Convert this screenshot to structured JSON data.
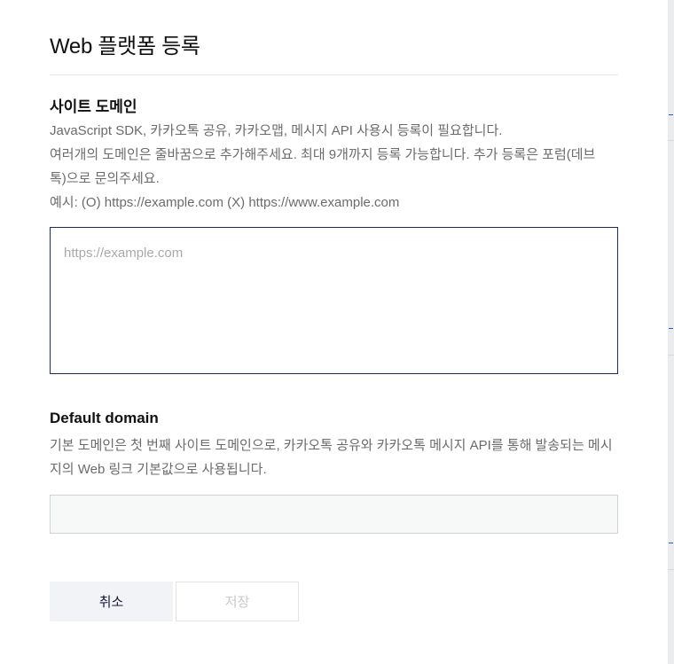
{
  "modal": {
    "title": "Web 플랫폼 등록"
  },
  "site_domain": {
    "heading": "사이트 도메인",
    "lines": [
      "JavaScript SDK, 카카오톡 공유, 카카오맵, 메시지 API 사용시 등록이 필요합니다.",
      "여러개의 도메인은 줄바꿈으로 추가해주세요. 최대 9개까지 등록 가능합니다. 추가 등록은 포럼(데브",
      "톡)으로 문의주세요.",
      "예시: (O) https://example.com (X) https://www.example.com"
    ],
    "placeholder": "https://example.com",
    "value": ""
  },
  "default_domain": {
    "heading": "Default domain",
    "lines": [
      "기본 도메인은 첫 번째 사이트 도메인으로, 카카오톡 공유와 카카오톡 메시지 API를 통해 발송되는 메시",
      "지의 Web 링크 기본값으로 사용됩니다."
    ],
    "value": ""
  },
  "buttons": {
    "cancel": "취소",
    "save": "저장"
  },
  "colors": {
    "border_focus": "#1b2b5c",
    "cancel_bg": "#f2f3f7",
    "disabled_text": "#c9c9c9"
  }
}
